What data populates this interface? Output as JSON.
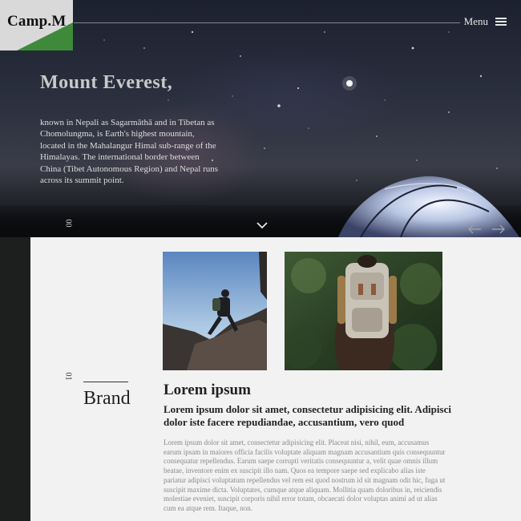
{
  "brand": {
    "logo_text": "Camp.M",
    "accent_color": "#3f8a3a"
  },
  "nav": {
    "menu_label": "Menu",
    "menu_icon": "hamburger-icon"
  },
  "hero": {
    "title": "Mount Everest,",
    "description": "known in Nepali as Sagarmāthā and in Tibetan as Chomolungma, is Earth's highest mountain, located in the Mahalangur Himal sub-range of the Himalayas. The international border between China (Tibet Autonomous Region) and Nepal runs across its summit point.",
    "slide_number": "00",
    "scroll_icon": "chevron-down-icon"
  },
  "slider": {
    "prev_icon": "arrow-left-icon",
    "next_icon": "arrow-right-icon"
  },
  "section": {
    "number": "01",
    "label": "Brand",
    "title": "Lorem ipsum",
    "subtitle": "Lorem ipsum dolor sit amet, consectetur adipisicing elit. Adipisci dolor iste facere repudiandae, accusantium, vero quod",
    "body": "Lorem ipsum dolor sit amet, consectetur adipisicing elit. Placeat nisi, nihil, eum, accusamus earum ipsam in maiores officia facilis voluptate aliquam magnam accusantium quis consequuntur consequatur repellendus. Earum saepe corrupti veritatis consequuntur a, velit quae omnis illum beatae, inventore enim ex suscipit illo nam. Quos ea tempore saepe sed explicabo alias iste pariatur adipisci voluptatum repellendus vel rem est quod nostrum id sit magnam odit hic, fuga ut suscipit maxime dicta. Voluptates, cumque atque aliquam. Mollitia quam doloribus in, reiciendis molestiae eveniet, suscipit corporis nihil error totam, obcaecati dolor voluptas animi ad ut alias cum ea atque rem. Itaque, non."
  }
}
